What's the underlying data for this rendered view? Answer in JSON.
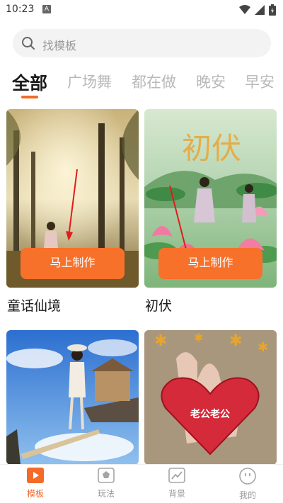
{
  "status": {
    "time": "10:23",
    "notification_badge": "A"
  },
  "search": {
    "placeholder": "找模板"
  },
  "tabs": [
    {
      "label": "全部"
    },
    {
      "label": "广场舞"
    },
    {
      "label": "都在做"
    },
    {
      "label": "晚安"
    },
    {
      "label": "早安"
    }
  ],
  "cards": [
    {
      "title": "童话仙境",
      "button": "马上制作"
    },
    {
      "title": "初伏",
      "button": "马上制作",
      "art_text": "初伏"
    },
    {
      "title": "",
      "button": ""
    },
    {
      "title": "",
      "art_text": "老公老公"
    }
  ],
  "bottom_nav": [
    {
      "label": "模板",
      "icon": "play-icon"
    },
    {
      "label": "玩法",
      "icon": "pentagon-icon"
    },
    {
      "label": "背景",
      "icon": "chart-icon"
    },
    {
      "label": "我的",
      "icon": "face-icon"
    }
  ],
  "colors": {
    "accent": "#f26b2b",
    "button": "#f7712a"
  }
}
